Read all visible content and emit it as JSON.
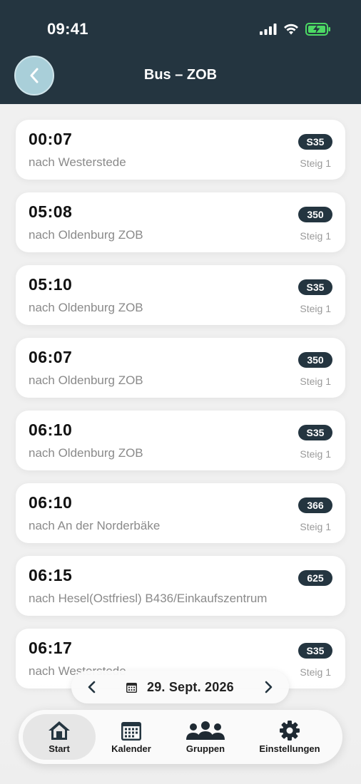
{
  "status": {
    "time": "09:41"
  },
  "header": {
    "title": "Bus – ZOB"
  },
  "departures": [
    {
      "time": "00:07",
      "destination": "nach Westerstede",
      "line": "S35",
      "platform": "Steig 1"
    },
    {
      "time": "05:08",
      "destination": "nach Oldenburg ZOB",
      "line": "350",
      "platform": "Steig 1"
    },
    {
      "time": "05:10",
      "destination": "nach Oldenburg ZOB",
      "line": "S35",
      "platform": "Steig 1"
    },
    {
      "time": "06:07",
      "destination": "nach Oldenburg ZOB",
      "line": "350",
      "platform": "Steig 1"
    },
    {
      "time": "06:10",
      "destination": "nach Oldenburg ZOB",
      "line": "S35",
      "platform": "Steig 1"
    },
    {
      "time": "06:10",
      "destination": "nach An der Norderbäke",
      "line": "366",
      "platform": "Steig 1"
    },
    {
      "time": "06:15",
      "destination": "nach Hesel(Ostfriesl) B436/Einkaufszentrum",
      "line": "625",
      "platform": ""
    },
    {
      "time": "06:17",
      "destination": "nach Westerstede",
      "line": "S35",
      "platform": "Steig 1"
    }
  ],
  "date_selector": {
    "label": "29. Sept. 2026"
  },
  "tabs": [
    {
      "label": "Start",
      "icon": "home-icon",
      "active": true
    },
    {
      "label": "Kalender",
      "icon": "calendar-icon",
      "active": false
    },
    {
      "label": "Gruppen",
      "icon": "group-icon",
      "active": false
    },
    {
      "label": "Einstellungen",
      "icon": "gear-icon",
      "active": false
    }
  ],
  "colors": {
    "header": "#243540",
    "badge": "#243540",
    "back_button": "#a9cfd9"
  }
}
